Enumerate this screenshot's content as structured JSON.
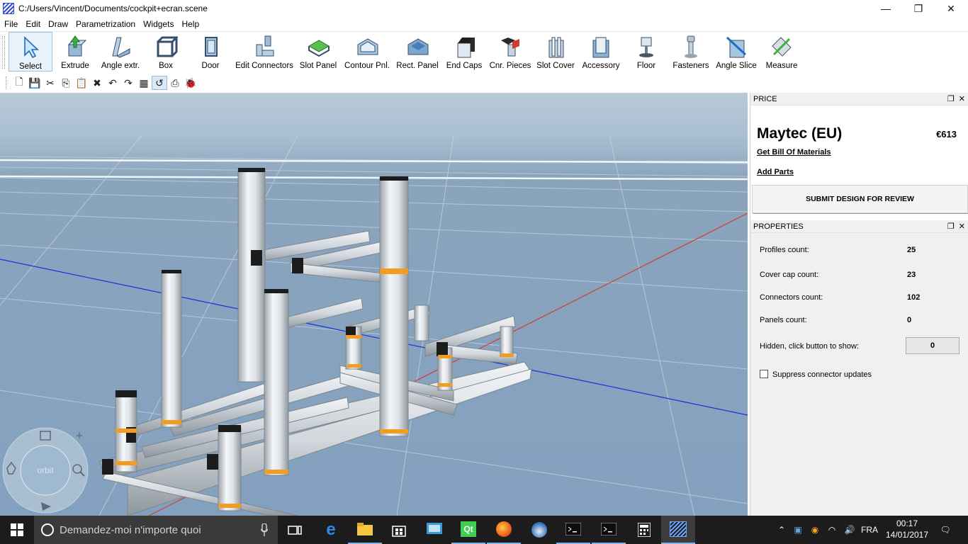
{
  "window": {
    "title": "C:/Users/Vincent/Documents/cockpit+ecran.scene",
    "minimize_glyph": "—",
    "restore_glyph": "❐",
    "close_glyph": "✕"
  },
  "menu": [
    "File",
    "Edit",
    "Draw",
    "Parametrization",
    "Widgets",
    "Help"
  ],
  "toolbar": [
    {
      "label": "Select",
      "icon": "cursor-arrow-icon"
    },
    {
      "label": "Extrude",
      "icon": "extrude-icon"
    },
    {
      "label": "Angle extr.",
      "icon": "angle-extrude-icon"
    },
    {
      "label": "Box",
      "icon": "box-icon"
    },
    {
      "label": "Door",
      "icon": "door-icon"
    },
    {
      "label": "Edit Connectors",
      "icon": "connectors-icon"
    },
    {
      "label": "Slot Panel",
      "icon": "slot-panel-icon"
    },
    {
      "label": "Contour Pnl.",
      "icon": "contour-panel-icon"
    },
    {
      "label": "Rect. Panel",
      "icon": "rect-panel-icon"
    },
    {
      "label": "End Caps",
      "icon": "end-caps-icon"
    },
    {
      "label": "Cnr. Pieces",
      "icon": "corner-pieces-icon"
    },
    {
      "label": "Slot Cover",
      "icon": "slot-cover-icon"
    },
    {
      "label": "Accessory",
      "icon": "accessory-icon"
    },
    {
      "label": "Floor",
      "icon": "floor-icon"
    },
    {
      "label": "Fasteners",
      "icon": "fasteners-icon"
    },
    {
      "label": "Angle Slice",
      "icon": "angle-slice-icon"
    },
    {
      "label": "Measure",
      "icon": "measure-icon"
    }
  ],
  "small_toolbar": [
    {
      "glyph": "🗋",
      "icon": "new-file-icon"
    },
    {
      "glyph": "💾",
      "icon": "save-icon"
    },
    {
      "glyph": "✂",
      "icon": "cut-icon"
    },
    {
      "glyph": "⎘",
      "icon": "copy-icon"
    },
    {
      "glyph": "📋",
      "icon": "paste-icon"
    },
    {
      "glyph": "✖",
      "icon": "delete-icon"
    },
    {
      "glyph": "↶",
      "icon": "undo-icon"
    },
    {
      "glyph": "↷",
      "icon": "redo-icon"
    },
    {
      "glyph": "▦",
      "icon": "grid-select-icon"
    },
    {
      "glyph": "↺",
      "icon": "rotate-icon"
    },
    {
      "glyph": "⎙",
      "icon": "export-icon"
    },
    {
      "glyph": "🐞",
      "icon": "debug-icon"
    }
  ],
  "navigator": {
    "center_label": "orbit"
  },
  "price_panel": {
    "title": "PRICE",
    "vendor": "Maytec (EU)",
    "price": "€613",
    "bom_link": "Get Bill Of Materials",
    "add_parts_link": "Add Parts",
    "submit_label": "SUBMIT DESIGN FOR REVIEW"
  },
  "properties_panel": {
    "title": "PROPERTIES",
    "rows": [
      {
        "label": "Profiles count:",
        "value": "25"
      },
      {
        "label": "Cover cap count:",
        "value": "23"
      },
      {
        "label": "Connectors count:",
        "value": "102"
      },
      {
        "label": "Panels count:",
        "value": "0"
      }
    ],
    "hidden_label": "Hidden, click button to show:",
    "hidden_value": "0",
    "suppress_label": "Suppress connector updates",
    "suppress_checked": false
  },
  "taskbar": {
    "search_placeholder": "Demandez-moi n'importe quoi",
    "language": "FRA",
    "time": "00:17",
    "date": "14/01/2017",
    "apps": [
      "task-view-icon",
      "edge-icon",
      "file-explorer-icon",
      "store-icon",
      "remote-desktop-icon",
      "qt-creator-icon",
      "firefox-icon",
      "thunderbird-icon",
      "terminal-icon",
      "terminal-icon",
      "calculator-icon",
      "app-scene-icon"
    ]
  },
  "colors": {
    "accent": "#7eb4ea",
    "viewport_bg": "#83a1bf",
    "profile_connector": "#f39c22",
    "axis_x": "#d9392f",
    "axis_z": "#1d2fd8"
  }
}
